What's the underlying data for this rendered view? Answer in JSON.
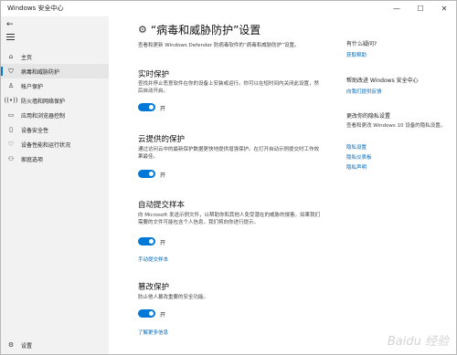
{
  "window": {
    "title": "Windows 安全中心"
  },
  "nav": {
    "back_icon": "back-arrow-icon",
    "items": [
      {
        "label": "主页",
        "icon": "home-icon",
        "active": false
      },
      {
        "label": "病毒和威胁防护",
        "icon": "shield-icon",
        "active": true
      },
      {
        "label": "帐户保护",
        "icon": "person-icon",
        "active": false
      },
      {
        "label": "防火墙和网络保护",
        "icon": "network-icon",
        "active": false
      },
      {
        "label": "应用和浏览器控制",
        "icon": "browser-icon",
        "active": false
      },
      {
        "label": "设备安全性",
        "icon": "device-icon",
        "active": false
      },
      {
        "label": "设备性能和运行状况",
        "icon": "heart-icon",
        "active": false
      },
      {
        "label": "家庭选项",
        "icon": "family-icon",
        "active": false
      }
    ],
    "settings": "设置"
  },
  "main": {
    "title": "“病毒和威胁防护”设置",
    "description": "查看和更新 Windows Defender 防病毒软件的“病毒和威胁防护”设置。",
    "sections": [
      {
        "heading": "实时保护",
        "text": "查找并停止恶意软件在你的设备上安装或运行。你可以在短时间内关闭此设置，然后自动开启。",
        "toggle_label": "开",
        "toggle_on": true,
        "link": ""
      },
      {
        "heading": "云提供的保护",
        "text": "通过访问云中的最新保护数据更快地提供增强保护。在打开自动示例提交时工作效果最佳。",
        "toggle_label": "开",
        "toggle_on": true,
        "link": ""
      },
      {
        "heading": "自动提交样本",
        "text": "向 Microsoft 发送示例文件，以帮助你和其他人免受潜在的威胁的侵害。如果我们需要的文件可能包含个人信息，我们将向你进行提示。",
        "toggle_label": "开",
        "toggle_on": true,
        "link": "手动提交样本"
      },
      {
        "heading": "篡改保护",
        "text": "防止他人篡改重要的安全功能。",
        "toggle_label": "开",
        "toggle_on": true,
        "link": "了解更多信息"
      }
    ]
  },
  "right": {
    "q_heading": "有什么疑问?",
    "q_link": "获取帮助",
    "improve_heading": "帮助改进 Windows 安全中心",
    "improve_link": "向我们提供反馈",
    "privacy_heading": "更改你的隐私设置",
    "privacy_text": "查看和更改 Windows 10 设备的隐私设置。",
    "privacy_links": [
      "隐私设置",
      "隐私仪表板",
      "隐私声明"
    ]
  },
  "watermark": "Baidu 经验"
}
